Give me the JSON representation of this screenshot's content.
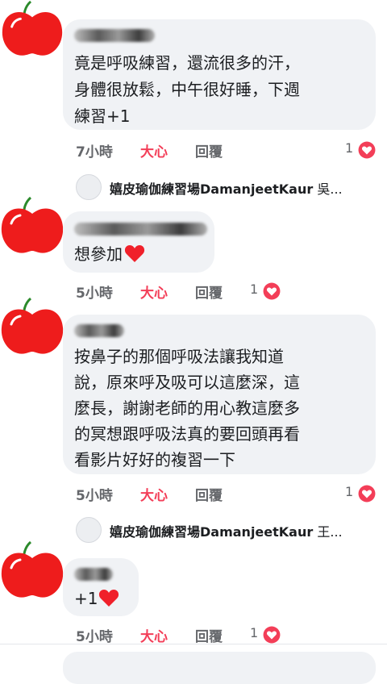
{
  "comments": [
    {
      "lines": [
        "竟是呼吸練習，還流很多的汗，",
        "身體很放鬆，中午很好睡，下週",
        "練習+1"
      ],
      "time": "7小時",
      "like": "大心",
      "reply": "回覆",
      "reaction_count": "1"
    },
    {
      "lines": [
        "想參加"
      ],
      "time": "5小時",
      "like": "大心",
      "reply": "回覆",
      "reaction_count": "1"
    },
    {
      "lines": [
        "按鼻子的那個呼吸法讓我知道",
        "說，原來呼及吸可以這麼深，這",
        "麼長，謝謝老師的用心教這麼多",
        "的冥想跟呼吸法真的要回頭再看",
        "看影片好好的複習一下"
      ],
      "time": "5小時",
      "like": "大心",
      "reply": "回覆",
      "reaction_count": "1"
    },
    {
      "lines": [
        "+1"
      ],
      "time": "5小時",
      "like": "大心",
      "reply": "回覆",
      "reaction_count": "1"
    }
  ],
  "replies": [
    {
      "author": "嬉皮瑜伽練習場DamanjeetKaur",
      "preview": " 吳..."
    },
    {
      "author": "嬉皮瑜伽練習場DamanjeetKaur",
      "preview": " 王..."
    }
  ],
  "colors": {
    "bubble": "#f0f2f5",
    "love": "#f33e58",
    "meta": "#65676b"
  },
  "icons": {
    "avatar": "apple-avatar-icon",
    "reaction": "heart-reaction-icon",
    "emoji": "red-heart-emoji-icon"
  }
}
